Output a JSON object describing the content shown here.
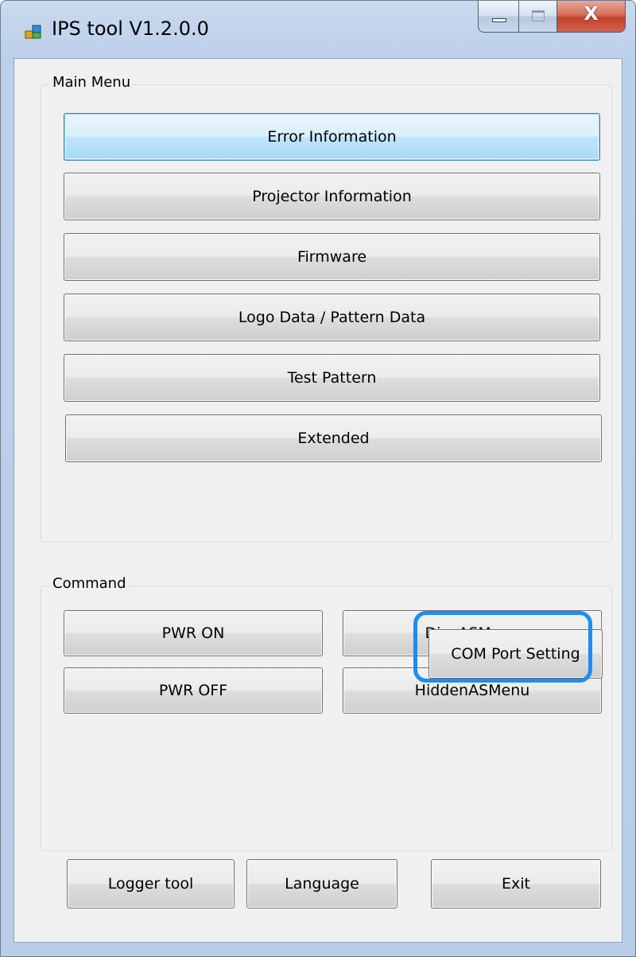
{
  "window": {
    "title": "IPS tool V1.2.0.0",
    "close_glyph": "X"
  },
  "main_menu": {
    "label": "Main Menu",
    "buttons": {
      "error_information": "Error Information",
      "projector_information": "Projector Information",
      "firmware": "Firmware",
      "logo_pattern_data": "Logo Data / Pattern Data",
      "test_pattern": "Test Pattern",
      "extended": "Extended"
    }
  },
  "command": {
    "label": "Command",
    "buttons": {
      "pwr_on": "PWR ON",
      "disp_as_menu": "DispASMenu",
      "pwr_off": "PWR OFF",
      "hidden_as_menu": "HiddenASMenu",
      "com_port_setting": "COM Port Setting"
    }
  },
  "footer": {
    "buttons": {
      "logger_tool": "Logger tool",
      "language": "Language",
      "exit": "Exit"
    }
  },
  "colors": {
    "highlight": "#1e8cf0"
  }
}
